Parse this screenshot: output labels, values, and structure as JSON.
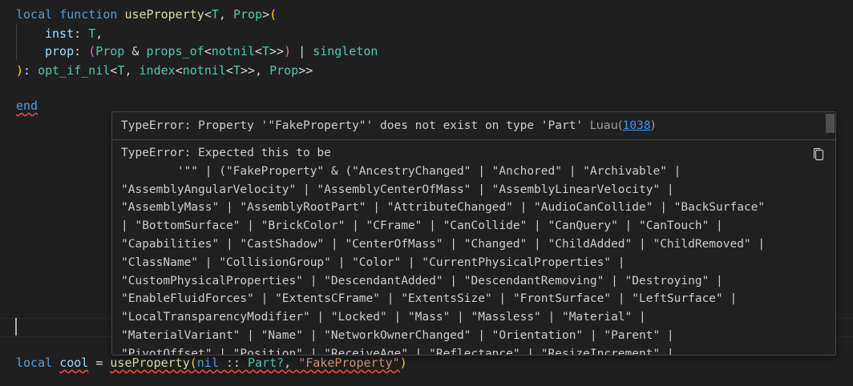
{
  "code": {
    "line1": {
      "kw1": "local",
      "kw2": "function",
      "fn": "useProperty",
      "lt": "<",
      "t": "T",
      "comma": ", ",
      "prop": "Prop",
      "gt": ">",
      "paren": "("
    },
    "line2": {
      "name": "inst",
      "colon": ": ",
      "type": "T",
      "comma": ","
    },
    "line3": {
      "name": "prop",
      "colon": ": ",
      "p1": "(",
      "prop": "Prop",
      "amp": " & ",
      "propsof": "props_of",
      "lt1": "<",
      "notnil": "notnil",
      "lt2": "<",
      "t": "T",
      "gt2": ">",
      "gt1": ">",
      "p2": ")",
      "bar": " | ",
      "singleton": "singleton"
    },
    "line4": {
      "rp": ")",
      "colon": ": ",
      "opt": "opt_if_nil",
      "lt1": "<",
      "t": "T",
      "comma1": ", ",
      "index": "index",
      "lt2": "<",
      "notnil": "notnil",
      "lt3": "<",
      "t2": "T",
      "gt3": ">",
      "gt2": ">",
      "comma2": ", ",
      "prop": "Prop",
      "gt1": ">",
      "gt0": ">"
    },
    "line6": {
      "kw": "end"
    },
    "line_last": {
      "kw": "local",
      "name": "cool",
      "eq": " = ",
      "fn": "useProperty",
      "p1": "(",
      "nil": "nil",
      "cast": " :: ",
      "type": "Part?",
      "comma": ", ",
      "str": "\"FakeProperty\"",
      "p2": ")"
    }
  },
  "hover": {
    "header_text": "TypeError: Property '\"FakeProperty\"' does not exist on type 'Part'",
    "source": "Luau(",
    "code": "1038",
    "source_end": ")",
    "lines": [
      "TypeError: Expected this to be",
      "        '\"\" | (\"FakeProperty\" & (\"AncestryChanged\" | \"Anchored\" | \"Archivable\" |",
      "\"AssemblyAngularVelocity\" | \"AssemblyCenterOfMass\" | \"AssemblyLinearVelocity\" |",
      "\"AssemblyMass\" | \"AssemblyRootPart\" | \"AttributeChanged\" | \"AudioCanCollide\" | \"BackSurface\"",
      "| \"BottomSurface\" | \"BrickColor\" | \"CFrame\" | \"CanCollide\" | \"CanQuery\" | \"CanTouch\" |",
      "\"Capabilities\" | \"CastShadow\" | \"CenterOfMass\" | \"Changed\" | \"ChildAdded\" | \"ChildRemoved\" |",
      "\"ClassName\" | \"CollisionGroup\" | \"Color\" | \"CurrentPhysicalProperties\" |",
      "\"CustomPhysicalProperties\" | \"DescendantAdded\" | \"DescendantRemoving\" | \"Destroying\" |",
      "\"EnableFluidForces\" | \"ExtentsCFrame\" | \"ExtentsSize\" | \"FrontSurface\" | \"LeftSurface\" |",
      "\"LocalTransparencyModifier\" | \"Locked\" | \"Mass\" | \"Massless\" | \"Material\" |",
      "\"MaterialVariant\" | \"Name\" | \"NetworkOwnerChanged\" | \"Orientation\" | \"Parent\" |",
      "\"PivotOffset\" | \"Position\" | \"ReceiveAge\" | \"Reflectance\" | \"ResizeIncrement\" |"
    ]
  },
  "icons": {
    "copy": "copy-icon"
  },
  "colors": {
    "keyword": "#569cd6",
    "function": "#dcdcaa",
    "type": "#4ec9b0",
    "string": "#ce9178",
    "error": "#f14c4c",
    "background": "#1f1f1f"
  }
}
